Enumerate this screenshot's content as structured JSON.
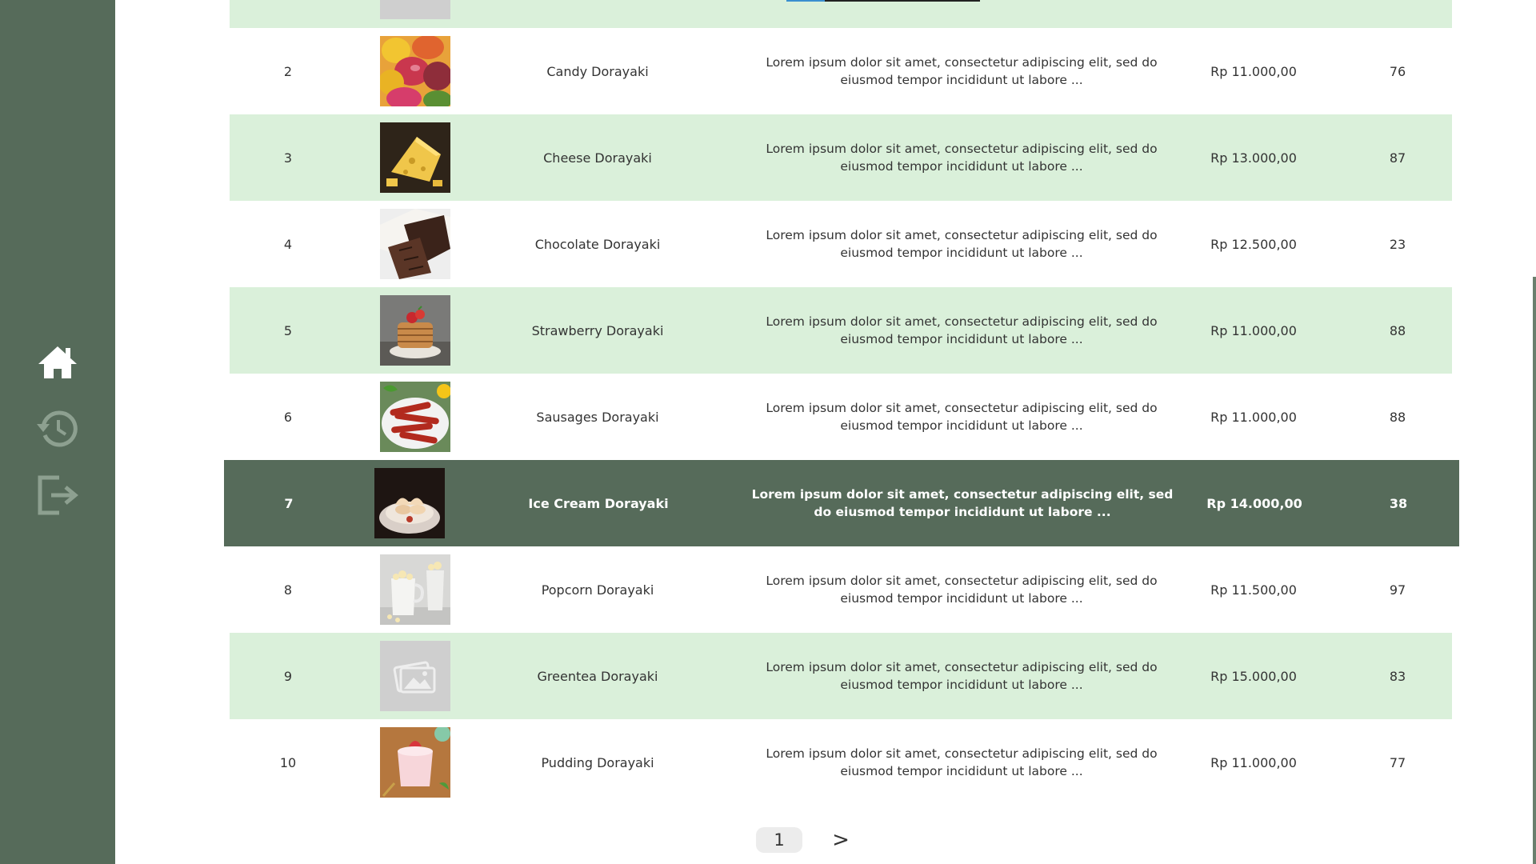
{
  "sidebar": {
    "items": [
      {
        "icon": "home-icon",
        "color": "#ffffff"
      },
      {
        "icon": "history-icon",
        "color": "#8da090"
      },
      {
        "icon": "logout-icon",
        "color": "#8da090"
      }
    ]
  },
  "colors": {
    "sidebar_bg": "#566b5a",
    "row_alt_bg": "#daf0da",
    "selected_bg": "#566b5a"
  },
  "table": {
    "rows": [
      {
        "no": "2",
        "image": "candy-image",
        "name": "Candy Dorayaki",
        "description": "Lorem ipsum dolor sit amet, consectetur adipiscing elit, sed do eiusmod tempor incididunt ut labore ...",
        "price": "Rp 11.000,00",
        "stock": "76"
      },
      {
        "no": "3",
        "image": "cheese-image",
        "name": "Cheese Dorayaki",
        "description": "Lorem ipsum dolor sit amet, consectetur adipiscing elit, sed do eiusmod tempor incididunt ut labore ...",
        "price": "Rp 13.000,00",
        "stock": "87"
      },
      {
        "no": "4",
        "image": "chocolate-image",
        "name": "Chocolate Dorayaki",
        "description": "Lorem ipsum dolor sit amet, consectetur adipiscing elit, sed do eiusmod tempor incididunt ut labore ...",
        "price": "Rp 12.500,00",
        "stock": "23"
      },
      {
        "no": "5",
        "image": "strawberry-pancake-image",
        "name": "Strawberry Dorayaki",
        "description": "Lorem ipsum dolor sit amet, consectetur adipiscing elit, sed do eiusmod tempor incididunt ut labore ...",
        "price": "Rp 11.000,00",
        "stock": "88"
      },
      {
        "no": "6",
        "image": "sausages-image",
        "name": "Sausages Dorayaki",
        "description": "Lorem ipsum dolor sit amet, consectetur adipiscing elit, sed do eiusmod tempor incididunt ut labore ...",
        "price": "Rp 11.000,00",
        "stock": "88"
      },
      {
        "no": "7",
        "image": "ice-cream-image",
        "name": "Ice Cream Dorayaki",
        "description": "Lorem ipsum dolor sit amet, consectetur adipiscing elit, sed do eiusmod tempor incididunt ut labore ...",
        "price": "Rp 14.000,00",
        "stock": "38"
      },
      {
        "no": "8",
        "image": "popcorn-image",
        "name": "Popcorn Dorayaki",
        "description": "Lorem ipsum dolor sit amet, consectetur adipiscing elit, sed do eiusmod tempor incididunt ut labore ...",
        "price": "Rp 11.500,00",
        "stock": "97"
      },
      {
        "no": "9",
        "image": "image-placeholder-icon",
        "name": "Greentea Dorayaki",
        "description": "Lorem ipsum dolor sit amet, consectetur adipiscing elit, sed do eiusmod tempor incididunt ut labore ...",
        "price": "Rp 15.000,00",
        "stock": "83"
      },
      {
        "no": "10",
        "image": "pudding-image",
        "name": "Pudding Dorayaki",
        "description": "Lorem ipsum dolor sit amet, consectetur adipiscing elit, sed do eiusmod tempor incididunt ut labore ...",
        "price": "Rp 11.000,00",
        "stock": "77"
      }
    ]
  },
  "pagination": {
    "current": "1",
    "next": ">"
  }
}
